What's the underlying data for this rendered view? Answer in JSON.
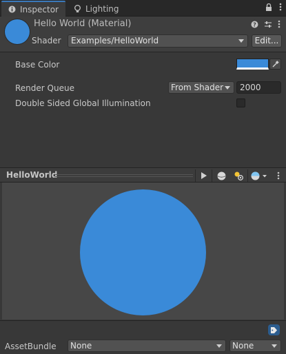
{
  "tabs": [
    {
      "label": "Inspector",
      "icon": "info-icon",
      "active": true
    },
    {
      "label": "Lighting",
      "icon": "light-bulb-icon",
      "active": false
    }
  ],
  "material": {
    "title": "Hello World (Material)",
    "shader_label": "Shader",
    "shader_value": "Examples/HelloWorld",
    "edit_label": "Edit..."
  },
  "properties": {
    "base_color_label": "Base Color",
    "base_color_value": "#3a8ad8",
    "render_queue_label": "Render Queue",
    "render_queue_mode": "From Shader",
    "render_queue_value": "2000",
    "gi_label": "Double Sided Global Illumination",
    "gi_checked": false
  },
  "preview": {
    "title": "HelloWorld",
    "sphere_color": "#3a8ad8"
  },
  "footer": {
    "asset_bundle_label": "AssetBundle",
    "bundle_name": "None",
    "bundle_variant": "None"
  },
  "colors": {
    "accent": "#3a79bb",
    "panel_bg": "#383838",
    "material_blue": "#3a8ad8"
  }
}
